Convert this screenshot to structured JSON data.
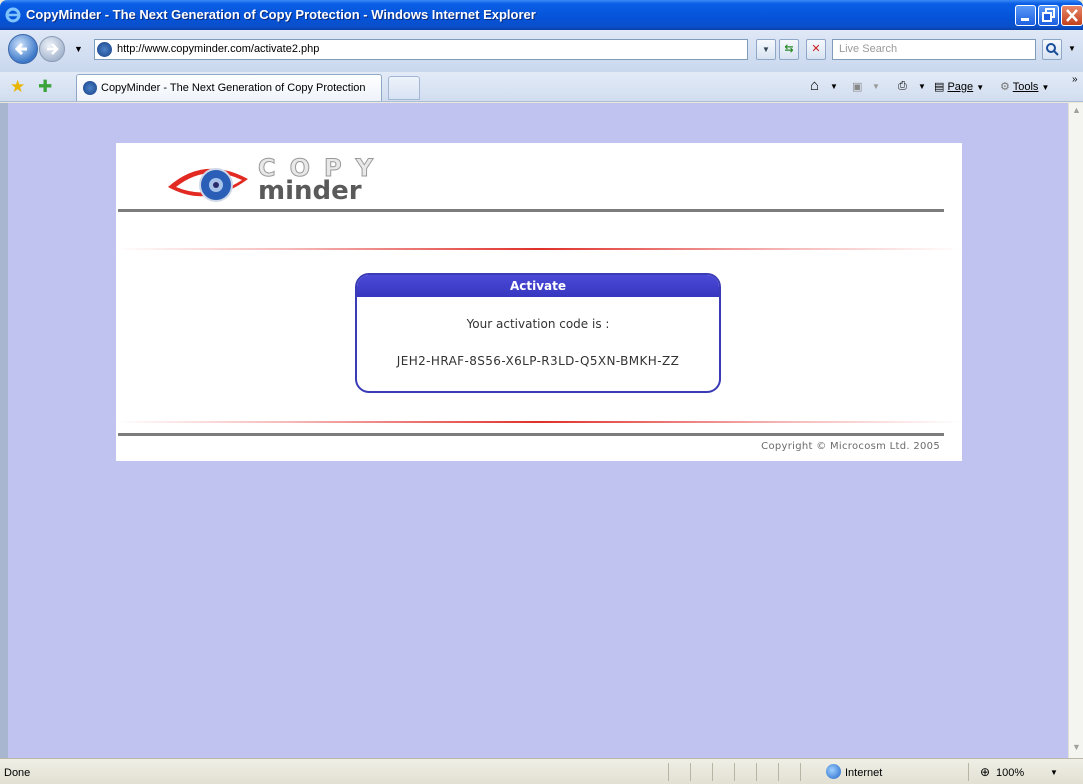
{
  "window": {
    "title": "CopyMinder - The Next Generation of Copy Protection - Windows Internet Explorer"
  },
  "address_bar": {
    "url": "http://www.copyminder.com/activate2.php",
    "search_placeholder": "Live Search"
  },
  "tabs": [
    {
      "label": "CopyMinder - The Next Generation of Copy Protection"
    }
  ],
  "command_bar": {
    "page_label": "Page",
    "tools_label": "Tools"
  },
  "page": {
    "logo_word1": "COPY",
    "logo_word2": "minder",
    "box_title": "Activate",
    "activation_text": "Your activation code is :",
    "activation_code": "JEH2-HRAF-8S56-X6LP-R3LD-Q5XN-BMKH-ZZ",
    "copyright": "Copyright © Microcosm Ltd. 2005"
  },
  "status_bar": {
    "status": "Done",
    "zone": "Internet",
    "zoom": "100%"
  },
  "colors": {
    "page_background": "#c0c3ef",
    "box_header": "#3b3bb5",
    "accent_red": "#e0302a"
  }
}
